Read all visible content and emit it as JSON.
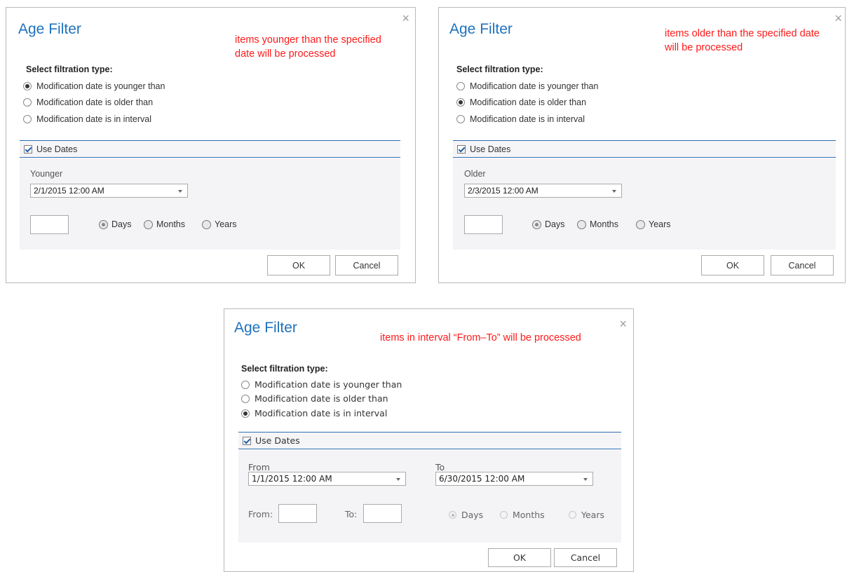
{
  "dialogs": [
    {
      "title": "Age Filter",
      "close": "×",
      "annotation": "items younger than the specified date will be processed",
      "annotation_lines": [
        "items younger than the specified",
        "date will be processed"
      ],
      "section_label": "Select filtration type:",
      "options": [
        "Modification date is younger than",
        "Modification date is older than",
        "Modification date is in interval"
      ],
      "selected": 0,
      "use_dates_label": "Use Dates",
      "use_dates_checked": true,
      "field_label": "Younger",
      "date_value": "2/1/2015 12:00 AM",
      "number_value": "",
      "units": [
        "Days",
        "Months",
        "Years"
      ],
      "unit_selected": 0,
      "ok": "OK",
      "cancel": "Cancel"
    },
    {
      "title": "Age Filter",
      "close": "×",
      "annotation": "items older than the specified date will be processed",
      "annotation_lines": [
        "items older than the specified date",
        "will be processed"
      ],
      "section_label": "Select filtration type:",
      "options": [
        "Modification date is younger than",
        "Modification date is older than",
        "Modification date is in interval"
      ],
      "selected": 1,
      "use_dates_label": "Use Dates",
      "use_dates_checked": true,
      "field_label": "Older",
      "date_value": "2/3/2015 12:00 AM",
      "number_value": "",
      "units": [
        "Days",
        "Months",
        "Years"
      ],
      "unit_selected": 0,
      "ok": "OK",
      "cancel": "Cancel"
    },
    {
      "title": "Age Filter",
      "close": "×",
      "annotation": "items in interval “From–To” will be processed",
      "section_label": "Select filtration type:",
      "options": [
        "Modification date is younger than",
        "Modification date is older than",
        "Modification date is in interval"
      ],
      "selected": 2,
      "use_dates_label": "Use Dates",
      "use_dates_checked": true,
      "from_label": "From",
      "to_label": "To",
      "from_date": "1/1/2015 12:00 AM",
      "to_date": "6/30/2015 12:00 AM",
      "from_num_label": "From:",
      "to_num_label": "To:",
      "units": [
        "Days",
        "Months",
        "Years"
      ],
      "unit_selected": 0,
      "ok": "OK",
      "cancel": "Cancel"
    }
  ],
  "colors": {
    "title": "#1f72bd",
    "annotation": "#ff1a1a",
    "separator": "#2f6fb5",
    "panel": "#f4f3f6"
  }
}
